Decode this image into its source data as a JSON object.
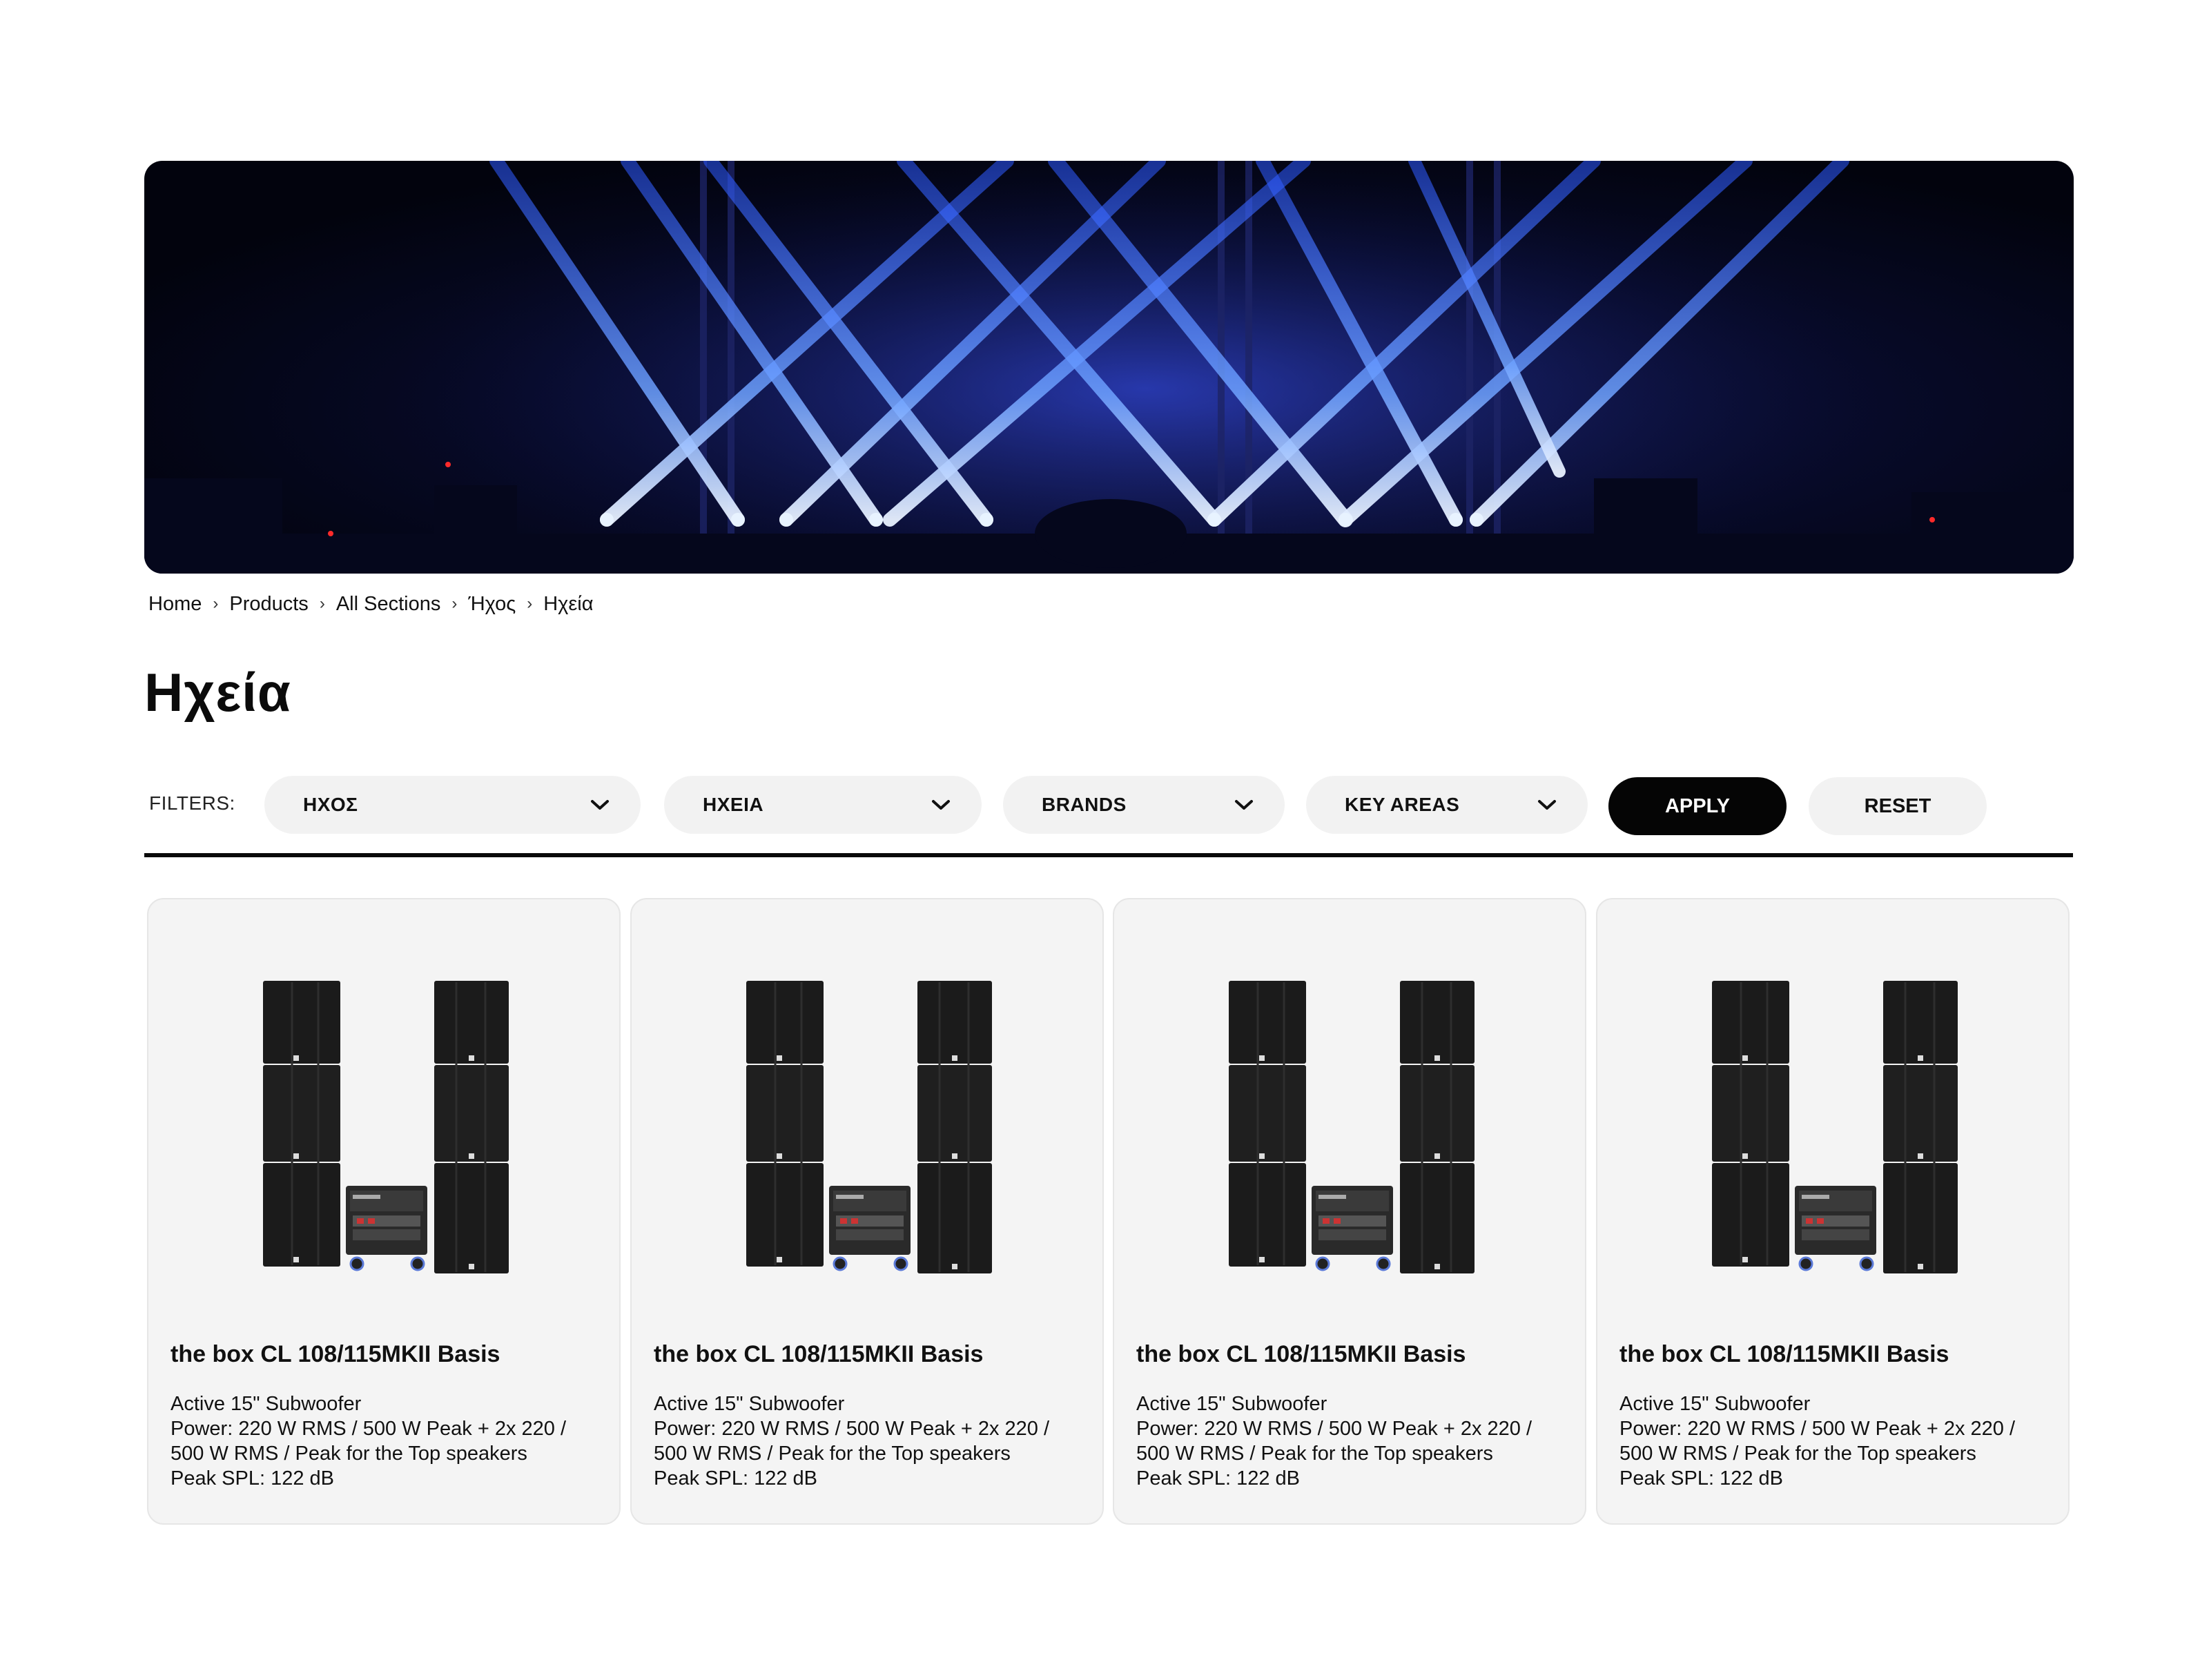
{
  "hero": {
    "image": "stage-blue-lights-banner"
  },
  "breadcrumb": [
    {
      "label": "Home"
    },
    {
      "label": "Products"
    },
    {
      "label": "All Sections"
    },
    {
      "label": "Ήχος"
    },
    {
      "label": "Ηχεία"
    }
  ],
  "breadcrumb_separator": "›",
  "page": {
    "title": "Ηχεία"
  },
  "filters": {
    "label": "FILTERS:",
    "dropdowns": [
      {
        "label": "ΗΧΟΣ",
        "icon": "chevron-down-icon"
      },
      {
        "label": "ΗΧΕΙΑ",
        "icon": "chevron-down-icon"
      },
      {
        "label": "BRANDS",
        "icon": "chevron-down-icon"
      },
      {
        "label": "KEY AREAS",
        "icon": "chevron-down-icon"
      }
    ],
    "apply_label": "APPLY",
    "reset_label": "RESET"
  },
  "products": [
    {
      "name": "the box CL 108/115MKII Basis",
      "lines": [
        "Active 15\" Subwoofer",
        "Power: 220 W RMS / 500 W Peak + 2x 220 / 500 W RMS / Peak for the Top speakers",
        "Peak SPL: 122 dB"
      ],
      "image": "speaker-system-image"
    },
    {
      "name": "the box CL 108/115MKII Basis",
      "lines": [
        "Active 15\" Subwoofer",
        "Power: 220 W RMS / 500 W Peak + 2x 220 / 500 W RMS / Peak for the Top speakers",
        "Peak SPL: 122 dB"
      ],
      "image": "speaker-system-image"
    },
    {
      "name": "the box CL 108/115MKII Basis",
      "lines": [
        "Active 15\" Subwoofer",
        "Power: 220 W RMS / 500 W Peak + 2x 220 / 500 W RMS / Peak for the Top speakers",
        "Peak SPL: 122 dB"
      ],
      "image": "speaker-system-image"
    },
    {
      "name": "the box CL 108/115MKII Basis",
      "lines": [
        "Active 15\" Subwoofer",
        "Power: 220 W RMS / 500 W Peak + 2x 220 / 500 W RMS / Peak for the Top speakers",
        "Peak SPL: 122 dB"
      ],
      "image": "speaker-system-image"
    }
  ],
  "colors": {
    "accent": "#050505",
    "pill_bg": "#f2f2f2",
    "card_bg": "#f4f4f4",
    "beam": "#3f7bff"
  }
}
